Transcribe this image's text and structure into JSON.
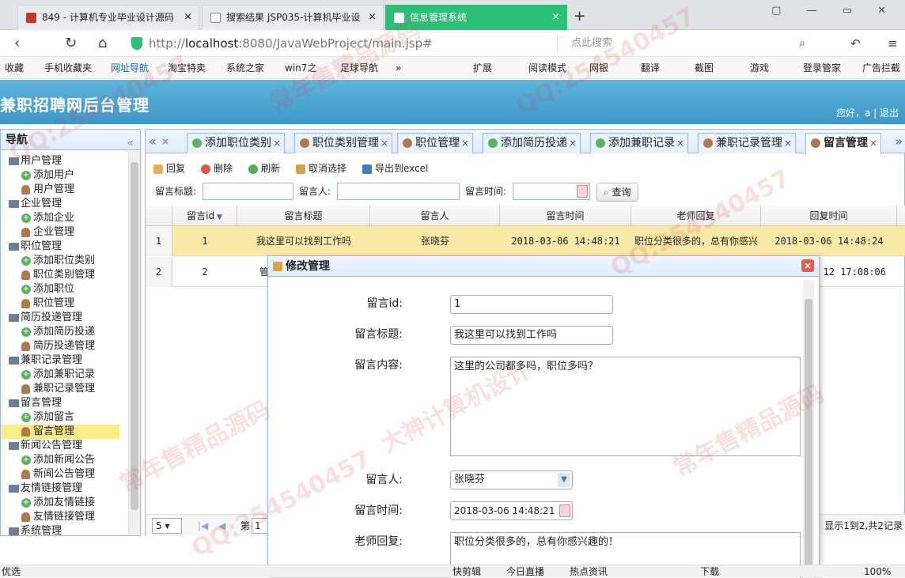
{
  "browser": {
    "tabs": [
      {
        "label": "849 - 计算机专业毕业设计源码",
        "active": false
      },
      {
        "label": "搜索结果 JSP035-计算机毕业设",
        "active": false
      },
      {
        "label": "信息管理系统",
        "active": true
      }
    ],
    "new_tab": "+",
    "close": "×",
    "url_prefix": "http://",
    "url_host": "localhost",
    "url_rest": ":8080/JavaWebProject/main.jsp#",
    "search_placeholder": "点此搜索",
    "bookmarks": [
      "收藏",
      "手机收藏夹",
      "网址导航",
      "淘宝特卖",
      "系统之家",
      "win7之",
      "足球导航",
      "»",
      "扩展",
      "阅读模式",
      "网银",
      "翻译",
      "截图",
      "游戏",
      "登录管家",
      "广告拦截"
    ]
  },
  "app": {
    "title": "兼职招聘网后台管理",
    "greeting": "您好，a | 退出"
  },
  "nav": {
    "title": "导航",
    "collapse": "«",
    "items": [
      {
        "label": "用户管理",
        "type": "group"
      },
      {
        "label": "添加用户",
        "type": "add"
      },
      {
        "label": "用户管理",
        "type": "user"
      },
      {
        "label": "企业管理",
        "type": "group"
      },
      {
        "label": "添加企业",
        "type": "add"
      },
      {
        "label": "企业管理",
        "type": "user"
      },
      {
        "label": "职位管理",
        "type": "group"
      },
      {
        "label": "添加职位类别",
        "type": "add"
      },
      {
        "label": "职位类别管理",
        "type": "user"
      },
      {
        "label": "添加职位",
        "type": "add"
      },
      {
        "label": "职位管理",
        "type": "user"
      },
      {
        "label": "简历投递管理",
        "type": "group"
      },
      {
        "label": "添加简历投递",
        "type": "add"
      },
      {
        "label": "简历投递管理",
        "type": "user"
      },
      {
        "label": "兼职记录管理",
        "type": "group"
      },
      {
        "label": "添加兼职记录",
        "type": "add"
      },
      {
        "label": "兼职记录管理",
        "type": "user"
      },
      {
        "label": "留言管理",
        "type": "group"
      },
      {
        "label": "添加留言",
        "type": "add"
      },
      {
        "label": "留言管理",
        "type": "user",
        "selected": true
      },
      {
        "label": "新闻公告管理",
        "type": "group"
      },
      {
        "label": "添加新闻公告",
        "type": "add"
      },
      {
        "label": "新闻公告管理",
        "type": "user"
      },
      {
        "label": "友情链接管理",
        "type": "group"
      },
      {
        "label": "添加友情链接",
        "type": "add"
      },
      {
        "label": "友情链接管理",
        "type": "user"
      },
      {
        "label": "系统管理",
        "type": "group"
      }
    ]
  },
  "main_tabs": {
    "scroll_left": "«",
    "scroll_right": "»",
    "items": [
      {
        "label": "添加职位类别",
        "icon": "add"
      },
      {
        "label": "职位类别管理",
        "icon": "user"
      },
      {
        "label": "职位管理",
        "icon": "user"
      },
      {
        "label": "添加简历投递",
        "icon": "add"
      },
      {
        "label": "添加兼职记录",
        "icon": "add"
      },
      {
        "label": "兼职记录管理",
        "icon": "user"
      },
      {
        "label": "留言管理",
        "icon": "user",
        "active": true
      }
    ]
  },
  "toolbar": {
    "reply": "回复",
    "delete": "删除",
    "refresh": "刷新",
    "cancel_select": "取消选择",
    "export": "导出到excel"
  },
  "search": {
    "title_label": "留言标题:",
    "person_label": "留言人:",
    "time_label": "留言时间:",
    "query": "查询"
  },
  "grid": {
    "columns": [
      "留言id",
      "留言标题",
      "留言人",
      "留言时间",
      "老师回复",
      "回复时间"
    ],
    "rows": [
      {
        "num": "1",
        "cells": [
          "1",
          "我这里可以找到工作吗",
          "张晓芬",
          "2018-03-06 14:48:21",
          "职位分类很多的，总有你感兴",
          "2018-03-06 14:48:24"
        ]
      },
      {
        "num": "2",
        "cells": [
          "2",
          "管",
          "",
          "",
          "",
          "12 17:08:06"
        ]
      }
    ]
  },
  "pager": {
    "page_size": "5",
    "page_label": "第",
    "page_num": "1",
    "summary": "显示1到2,共2记录"
  },
  "dialog": {
    "title": "修改管理",
    "close": "×",
    "fields": {
      "id_label": "留言id:",
      "id_value": "1",
      "title_label": "留言标题:",
      "title_value": "我这里可以找到工作吗",
      "content_label": "留言内容:",
      "content_value": "这里的公司都多吗，职位多吗？",
      "person_label": "留言人:",
      "person_value": "张晓芬",
      "time_label": "留言时间:",
      "time_value": "2018-03-06 14:48:21",
      "reply_label": "老师回复:",
      "reply_value": "职位分类很多的，总有你感兴趣的！"
    }
  },
  "statusbar": {
    "left": "优选",
    "items": [
      "快剪辑",
      "今日直播",
      "热点资讯",
      "下载",
      "100%"
    ]
  },
  "watermarks": [
    "QQ:254540457",
    "常年售精品源码",
    "大神计算机设计"
  ],
  "colors": {
    "accent": "#2bbf77",
    "header": "#4aa3d3",
    "highlight_row": "#fbe9a9",
    "border": "#95b8e7"
  }
}
